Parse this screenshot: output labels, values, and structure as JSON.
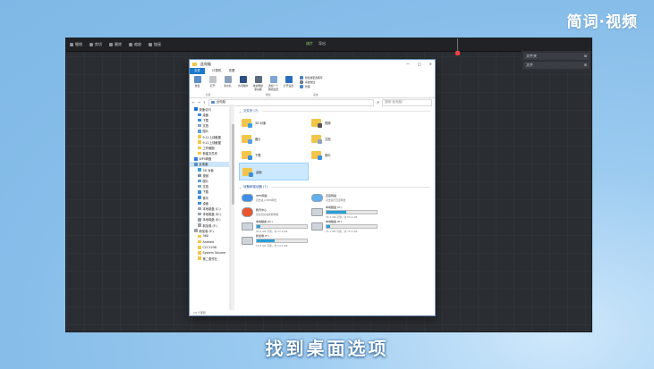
{
  "brand": "简词·视频",
  "subtitle": "找到桌面选项",
  "editor": {
    "toolbar_left": [
      "撤销",
      "剪切",
      "删除",
      "缩放",
      "链接"
    ],
    "toolbar_center": [
      "成片",
      "导出"
    ],
    "panel_rows": [
      {
        "label": "文件夹",
        "val": "⊞"
      },
      {
        "label": "文件",
        "val": "⊞"
      }
    ]
  },
  "explorer": {
    "title": "此电脑",
    "controls": {
      "min": "—",
      "max": "□",
      "close": "✕"
    },
    "ribbon_tabs": [
      "文件",
      "计算机",
      "查看"
    ],
    "ribbon_buttons": [
      "属性",
      "打开",
      "重命名",
      "访问媒体",
      "映射网络驱动器",
      "添加一个网络位置",
      "打开设置"
    ],
    "ribbon_side": [
      "卸载或更改程序",
      "系统属性",
      "管理"
    ],
    "ribbon_groups": [
      "位置",
      "网络",
      "系统"
    ],
    "address": "此电脑",
    "search_placeholder": "搜索\"此电脑\"",
    "nav": [
      {
        "label": "快速访问",
        "level": 0,
        "color": "#1e6fd0"
      },
      {
        "label": "桌面",
        "level": 1,
        "color": "#3a8fe0"
      },
      {
        "label": "下载",
        "level": 1,
        "color": "#3a8fe0"
      },
      {
        "label": "文档",
        "level": 1,
        "color": "#8da3bd"
      },
      {
        "label": "图片",
        "level": 1,
        "color": "#5c9ee6"
      },
      {
        "label": "9.11上线截图",
        "level": 1,
        "color": "#f3c64a"
      },
      {
        "label": "9.11上线截图",
        "level": 1,
        "color": "#f3c64a"
      },
      {
        "label": "工作截图",
        "level": 1,
        "color": "#f3c64a"
      },
      {
        "label": "新建文件夹",
        "level": 1,
        "color": "#f3c64a"
      },
      {
        "label": "WPS网盘",
        "level": 0,
        "color": "#2d7ae6"
      },
      {
        "label": "此电脑",
        "level": 0,
        "color": "#5b8fc9",
        "selected": true
      },
      {
        "label": "3D 对象",
        "level": 1,
        "color": "#3aa0e0"
      },
      {
        "label": "视频",
        "level": 1,
        "color": "#7b8ca0"
      },
      {
        "label": "图片",
        "level": 1,
        "color": "#5c9ee6"
      },
      {
        "label": "文档",
        "level": 1,
        "color": "#8da3bd"
      },
      {
        "label": "下载",
        "level": 1,
        "color": "#3a8fe0"
      },
      {
        "label": "音乐",
        "level": 1,
        "color": "#3a8fe0"
      },
      {
        "label": "桌面",
        "level": 1,
        "color": "#3a8fe0"
      },
      {
        "label": "本地磁盘 (C:)",
        "level": 1,
        "color": "#9aa1a9"
      },
      {
        "label": "本地磁盘 (D:)",
        "level": 1,
        "color": "#9aa1a9"
      },
      {
        "label": "本地磁盘 (E:)",
        "level": 1,
        "color": "#9aa1a9"
      },
      {
        "label": "新加卷 (F:)",
        "level": 1,
        "color": "#9aa1a9"
      },
      {
        "label": "新加卷 (F:)",
        "level": 0,
        "color": "#9aa1a9"
      },
      {
        "label": "360",
        "level": 1,
        "color": "#f3c64a"
      },
      {
        "label": "Android",
        "level": 1,
        "color": "#f3c64a"
      },
      {
        "label": "CCC1208",
        "level": 1,
        "color": "#f3c64a"
      },
      {
        "label": "System Volume",
        "level": 1,
        "color": "#f3c64a"
      },
      {
        "label": "第二套作业",
        "level": 1,
        "color": "#f3c64a"
      }
    ],
    "folders_header": "文件夹 (7)",
    "folders": [
      {
        "label": "3D 对象",
        "badge": "#3aa0e0"
      },
      {
        "label": "视频",
        "badge": "#555"
      },
      {
        "label": "图片",
        "badge": "#5c9ee6"
      },
      {
        "label": "文档",
        "badge": "#8da3bd"
      },
      {
        "label": "下载",
        "badge": "#3a8fe0"
      },
      {
        "label": "音乐",
        "badge": "#3a8fe0"
      },
      {
        "label": "桌面",
        "badge": "#3a8fe0",
        "selected": true
      }
    ],
    "devices_header": "设备和驱动器 (7)",
    "devices": [
      {
        "label": "WPS网盘",
        "sub": "双击进入WPS网盘",
        "kind": "cloud"
      },
      {
        "label": "百度网盘",
        "sub": "双击运行百度网盘",
        "kind": "cloud2"
      },
      {
        "label": "腾讯中心",
        "sub": "双击直接看视频教程",
        "kind": "app"
      },
      {
        "label": "本地磁盘 (C:)",
        "sub": "35.2 GB 可用，共 59.1 GB",
        "kind": "drive",
        "fill": 0.4
      },
      {
        "label": "本地磁盘 (D:)",
        "sub": "25.6 GB 可用，共 27.9 GB",
        "kind": "drive",
        "fill": 0.08
      },
      {
        "label": "本地磁盘 (E:)",
        "sub": "71.1 GB 可用，共 76.5 GB",
        "kind": "drive",
        "fill": 0.07
      },
      {
        "label": "新加卷 (F:)",
        "sub": "15.6 GB 可用，共 24.5 GB",
        "kind": "drive",
        "fill": 0.36
      }
    ],
    "status": "14 个项目"
  }
}
